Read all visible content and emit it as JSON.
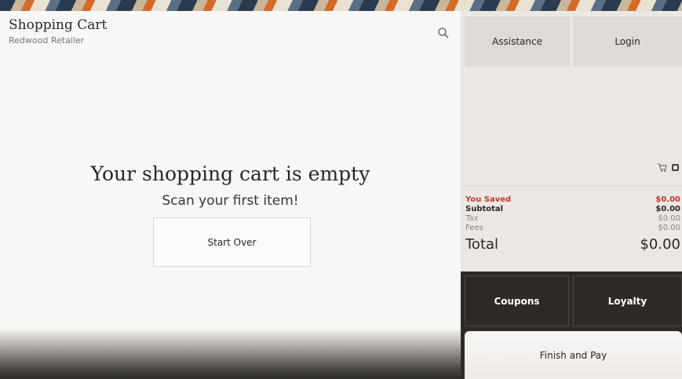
{
  "header": {
    "title": "Shopping Cart",
    "subtitle": "Redwood Retailer"
  },
  "cart": {
    "empty_title": "Your shopping cart is empty",
    "empty_sub": "Scan your first item!",
    "start_over_label": "Start Over"
  },
  "actions": {
    "assistance_label": "Assistance",
    "login_label": "Login",
    "coupons_label": "Coupons",
    "loyalty_label": "Loyalty",
    "finish_label": "Finish and Pay"
  },
  "totals": {
    "saved_label": "You Saved",
    "saved_value": "$0.00",
    "subtotal_label": "Subtotal",
    "subtotal_value": "$0.00",
    "tax_label": "Tax",
    "tax_value": "$0.00",
    "fees_label": "Fees",
    "fees_value": "$0.00",
    "total_label": "Total",
    "total_value": "$0.00"
  },
  "icons": {
    "search": "search-icon",
    "cart": "cart-icon",
    "toggle": "toggle-icon"
  },
  "colors": {
    "saved": "#c0392b",
    "dark_panel": "#2f2a26",
    "light_button": "#dedad5"
  }
}
